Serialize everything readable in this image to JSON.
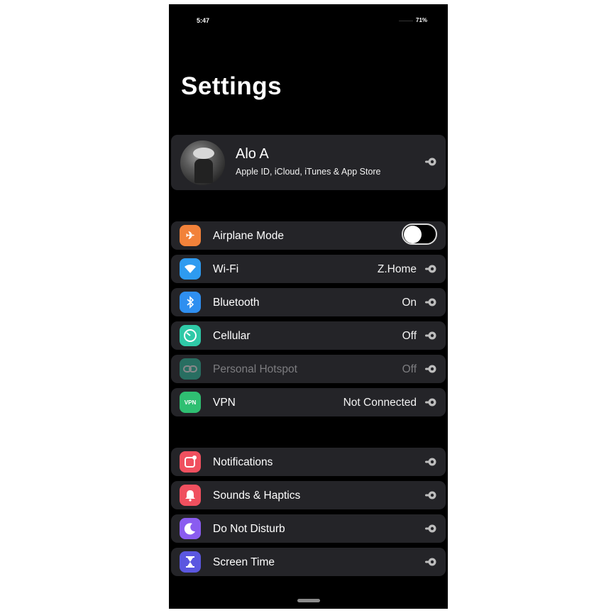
{
  "status_bar": {
    "time": "5:47",
    "battery": "71%"
  },
  "header": {
    "title": "Settings"
  },
  "profile": {
    "name": "Alo A",
    "subtitle": "Apple ID, iCloud, iTunes & App Store",
    "chevron_icon": "link-chevron-icon"
  },
  "connectivity": [
    {
      "label": "Airplane Mode",
      "icon": "airplane-icon",
      "color": "#f2823a",
      "toggle": false
    },
    {
      "label": "Wi-Fi",
      "value": "Z.Home",
      "icon": "wifi-icon",
      "color": "#2e9bf0"
    },
    {
      "label": "Bluetooth",
      "value": "On",
      "icon": "bluetooth-icon",
      "color": "#2f8ff0"
    },
    {
      "label": "Cellular",
      "value": "Off",
      "icon": "cellular-gauge-icon",
      "color": "#2fc9a7"
    },
    {
      "label": "Personal Hotspot",
      "value": "Off",
      "icon": "hotspot-link-icon",
      "color": "#2fc9a7",
      "disabled": true
    },
    {
      "label": "VPN",
      "value": "Not Connected",
      "icon_text": "VPN",
      "icon": "vpn-icon",
      "color": "#2fbf72"
    }
  ],
  "general": [
    {
      "label": "Notifications",
      "icon": "notifications-icon",
      "color": "#f0505f"
    },
    {
      "label": "Sounds & Haptics",
      "icon": "bell-icon",
      "color": "#f0505f"
    },
    {
      "label": "Do Not Disturb",
      "icon": "moon-icon",
      "color": "#8a5cf0"
    },
    {
      "label": "Screen Time",
      "icon": "hourglass-icon",
      "color": "#5b57e0"
    }
  ]
}
